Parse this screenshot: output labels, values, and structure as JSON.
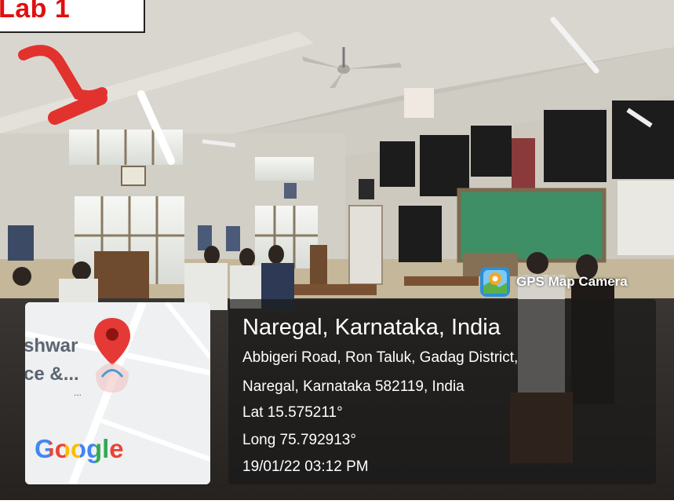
{
  "overlay_label": "Lab 1",
  "gps_badge": {
    "label": "GPS Map Camera",
    "icon": "gps-map-camera-icon"
  },
  "map": {
    "text_line_1": "shwar",
    "text_line_2": "ce &...",
    "ellipsis": "...",
    "brand": "Google",
    "pin_icon": "location-pin-icon",
    "pin_color": "#e53935"
  },
  "location": {
    "title": "Naregal, Karnataka, India",
    "address_line_1": "Abbigeri Road, Ron Taluk, Gadag District,",
    "address_line_2": "Naregal, Karnataka 582119, India",
    "lat": "Lat 15.575211°",
    "long": "Long 75.792913°",
    "datetime": "19/01/22 03:12 PM"
  }
}
